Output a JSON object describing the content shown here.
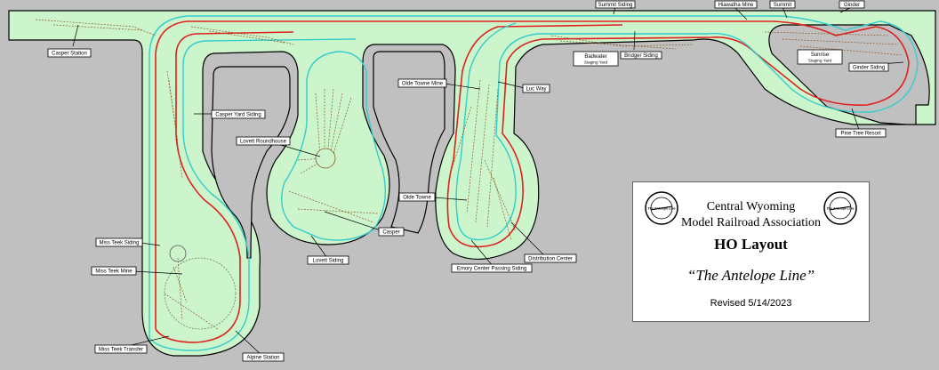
{
  "labels": {
    "casper_station": "Casper Station",
    "summit_siding": "Summit Siding",
    "hiawatha_mine": "Hiawatha Mine",
    "summit": "Summit",
    "ginder": "Ginder",
    "badwater": "Badwater",
    "badwater_sub": "Staging Yard",
    "bridger_siding": "Bridger Siding",
    "sunrise": "Sunrise",
    "sunrise_sub": "Staging Yard",
    "ginder_siding": "Ginder Siding",
    "pine_tree_resort": "Pine Tree Resort",
    "casper_yard_siding": "Casper Yard Siding",
    "lovett_roundhouse": "Lovett Roundhouse",
    "casper": "Casper",
    "lovett_siding": "Lovett Siding",
    "olde_towne_mine": "Olde Towne Mine",
    "luc_way": "Luc Way",
    "olde_towne": "Olde Towne",
    "distribution_center": "Distribution Center",
    "emory_center_passing_siding": "Emory Center Passing Siding",
    "miss_teek_siding": "Miss Teek Siding",
    "miss_teek_mine": "Miss Teek Mine",
    "miss_teek_transfer": "Miss Teek Transfer",
    "alpine_station": "Alpine Station"
  },
  "title_block": {
    "org_line1": "Central Wyoming",
    "org_line2": "Model Railroad Association",
    "layout": "HO Layout",
    "name": "“The Antelope Line”",
    "revised": "Revised 5/14/2023"
  },
  "logo": {
    "ring_text": "CENTRAL WYOMING",
    "center_text": "The Antelope Line"
  },
  "colors": {
    "background": "#c0c0c0",
    "benchwork_fill": "#ccf5cc",
    "benchwork_border": "#000000",
    "mainline_red": "#e02020",
    "track_cyan": "#33cccc",
    "spur_brown": "#8b5a2b"
  }
}
